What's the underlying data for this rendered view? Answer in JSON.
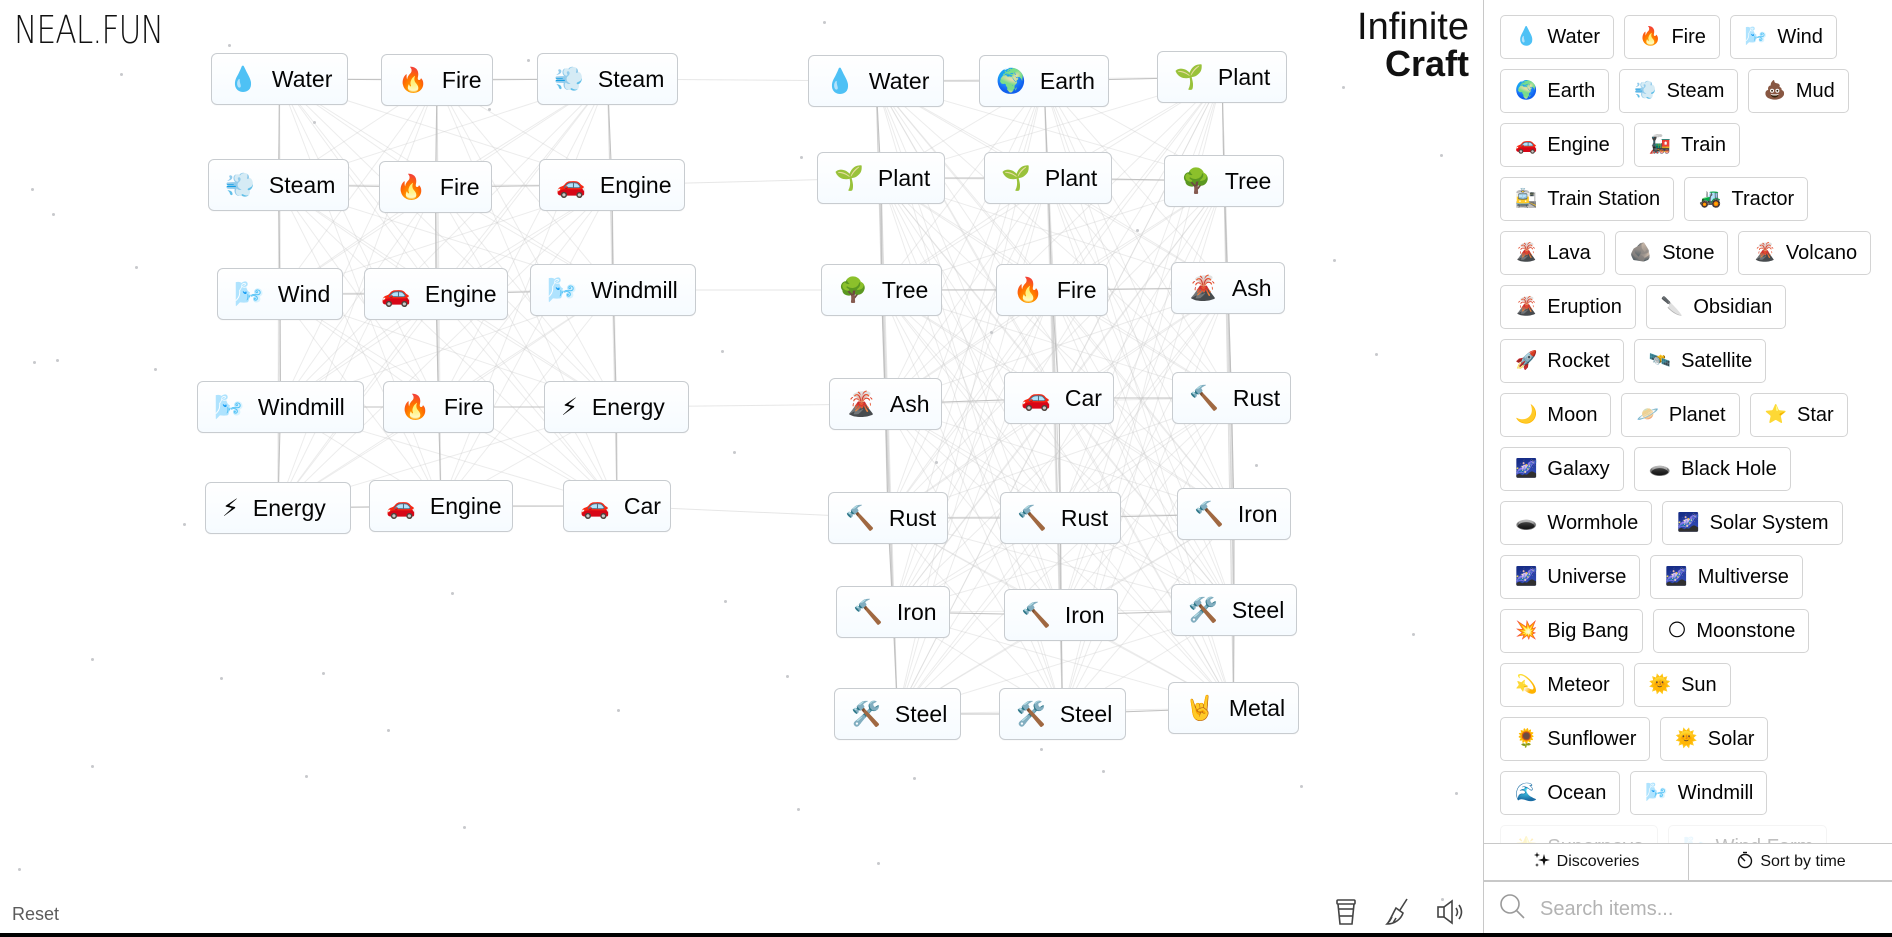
{
  "branding": {
    "site_logo": "NEAL.FUN",
    "app_title_line1": "Infinite",
    "app_title_line2": "Craft"
  },
  "canvas": {
    "nodes": [
      {
        "emoji": "💧",
        "label": "Water"
      },
      {
        "emoji": "🔥",
        "label": "Fire"
      },
      {
        "emoji": "💨",
        "label": "Steam"
      },
      {
        "emoji": "💨",
        "label": "Steam"
      },
      {
        "emoji": "🔥",
        "label": "Fire"
      },
      {
        "emoji": "🚗",
        "label": "Engine"
      },
      {
        "emoji": "🌬️",
        "label": "Wind"
      },
      {
        "emoji": "🚗",
        "label": "Engine"
      },
      {
        "emoji": "🌬️",
        "label": "Windmill"
      },
      {
        "emoji": "🌬️",
        "label": "Windmill"
      },
      {
        "emoji": "🔥",
        "label": "Fire"
      },
      {
        "emoji": "⚡",
        "label": "Energy"
      },
      {
        "emoji": "⚡",
        "label": "Energy"
      },
      {
        "emoji": "🚗",
        "label": "Engine"
      },
      {
        "emoji": "🚗",
        "label": "Car"
      },
      {
        "emoji": "💧",
        "label": "Water"
      },
      {
        "emoji": "🌍",
        "label": "Earth"
      },
      {
        "emoji": "🌱",
        "label": "Plant"
      },
      {
        "emoji": "🌱",
        "label": "Plant"
      },
      {
        "emoji": "🌱",
        "label": "Plant"
      },
      {
        "emoji": "🌳",
        "label": "Tree"
      },
      {
        "emoji": "🌳",
        "label": "Tree"
      },
      {
        "emoji": "🔥",
        "label": "Fire"
      },
      {
        "emoji": "🌋",
        "label": "Ash"
      },
      {
        "emoji": "🌋",
        "label": "Ash"
      },
      {
        "emoji": "🚗",
        "label": "Car"
      },
      {
        "emoji": "🔨",
        "label": "Rust"
      },
      {
        "emoji": "🔨",
        "label": "Rust"
      },
      {
        "emoji": "🔨",
        "label": "Rust"
      },
      {
        "emoji": "🔨",
        "label": "Iron"
      },
      {
        "emoji": "🔨",
        "label": "Iron"
      },
      {
        "emoji": "🔨",
        "label": "Iron"
      },
      {
        "emoji": "🛠️",
        "label": "Steel"
      },
      {
        "emoji": "🛠️",
        "label": "Steel"
      },
      {
        "emoji": "🛠️",
        "label": "Steel"
      },
      {
        "emoji": "🤘",
        "label": "Metal"
      }
    ],
    "reset_label": "Reset",
    "tools": [
      {
        "name": "donate-cup-icon",
        "glyph": "☕"
      },
      {
        "name": "clear-broom-icon",
        "glyph": "🧹"
      },
      {
        "name": "sound-icon",
        "glyph": "🔊"
      }
    ]
  },
  "sidebar": {
    "items": [
      {
        "emoji": "💧",
        "label": "Water"
      },
      {
        "emoji": "🔥",
        "label": "Fire"
      },
      {
        "emoji": "🌬️",
        "label": "Wind"
      },
      {
        "emoji": "🌍",
        "label": "Earth"
      },
      {
        "emoji": "💨",
        "label": "Steam"
      },
      {
        "emoji": "💩",
        "label": "Mud"
      },
      {
        "emoji": "🚗",
        "label": "Engine"
      },
      {
        "emoji": "🚂",
        "label": "Train"
      },
      {
        "emoji": "🚉",
        "label": "Train Station"
      },
      {
        "emoji": "🚜",
        "label": "Tractor"
      },
      {
        "emoji": "🌋",
        "label": "Lava"
      },
      {
        "emoji": "🪨",
        "label": "Stone"
      },
      {
        "emoji": "🌋",
        "label": "Volcano"
      },
      {
        "emoji": "🌋",
        "label": "Eruption"
      },
      {
        "emoji": "🔪",
        "label": "Obsidian"
      },
      {
        "emoji": "🚀",
        "label": "Rocket"
      },
      {
        "emoji": "🛰️",
        "label": "Satellite"
      },
      {
        "emoji": "🌙",
        "label": "Moon"
      },
      {
        "emoji": "🪐",
        "label": "Planet"
      },
      {
        "emoji": "⭐",
        "label": "Star"
      },
      {
        "emoji": "🌌",
        "label": "Galaxy"
      },
      {
        "emoji": "🕳️",
        "label": "Black Hole"
      },
      {
        "emoji": "🕳️",
        "label": "Wormhole"
      },
      {
        "emoji": "🌌",
        "label": "Solar System"
      },
      {
        "emoji": "🌌",
        "label": "Universe"
      },
      {
        "emoji": "🌌",
        "label": "Multiverse"
      },
      {
        "emoji": "💥",
        "label": "Big Bang"
      },
      {
        "emoji": "🌕",
        "label": "Moonstone"
      },
      {
        "emoji": "💫",
        "label": "Meteor"
      },
      {
        "emoji": "🌞",
        "label": "Sun"
      },
      {
        "emoji": "🌻",
        "label": "Sunflower"
      },
      {
        "emoji": "🌞",
        "label": "Solar"
      },
      {
        "emoji": "🌊",
        "label": "Ocean"
      },
      {
        "emoji": "🌬️",
        "label": "Windmill"
      },
      {
        "emoji": "🌟",
        "label": "Supernova",
        "faded": true
      },
      {
        "emoji": "🌬️",
        "label": "Wind Farm",
        "faded": true
      }
    ],
    "tabs": {
      "discoveries_label": "Discoveries",
      "sort_label": "Sort by time"
    },
    "search": {
      "placeholder": "Search items...",
      "value": ""
    }
  }
}
